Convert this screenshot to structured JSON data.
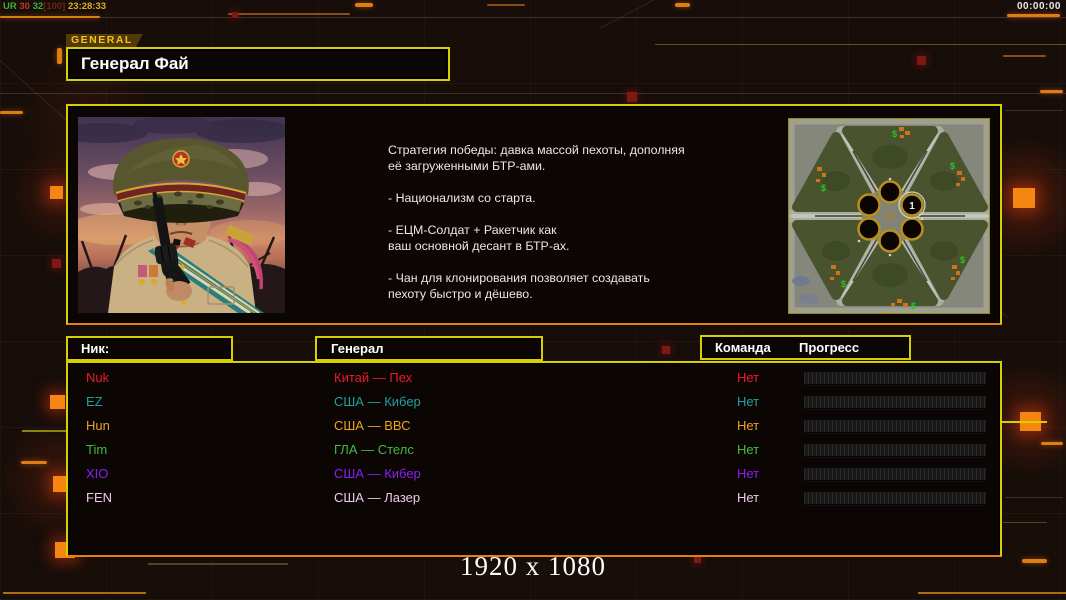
{
  "hud": {
    "stats": [
      {
        "text": "UR ",
        "color": "#3fae3f"
      },
      {
        "text": "30 ",
        "color": "#c23a26"
      },
      {
        "text": "32",
        "color": "#3fae3f"
      },
      {
        "text": "[100] ",
        "color": "#6e2418"
      },
      {
        "text": "23:28:33",
        "color": "#d9b31e"
      }
    ],
    "timer": "00:00:00"
  },
  "header": {
    "tab": "GENERAL",
    "title": "Генерал Фай"
  },
  "info": {
    "strategy_text": "Стратегия победы: давка массой пехоты, дополняя\n её загруженными БТР-ами.\n\n- Национализм со старта.\n\n- ЕЦМ-Солдат + Ракетчик как\nваш основной десант в БТР-ах.\n\n- Чан для клонирования позволяет создавать\n пехоту быстро и дёшево."
  },
  "map": {
    "position_label": "1"
  },
  "table": {
    "headers": {
      "nick": "Ник:",
      "general": "Генерал",
      "team": "Команда",
      "progress": "Прогресс"
    },
    "rows": [
      {
        "nick": "Nuk",
        "general": "Китай — Пех",
        "team": "Нет",
        "color": "#f01a28",
        "progress_percent": 0
      },
      {
        "nick": "EZ",
        "general": "США — Кибер",
        "team": "Нет",
        "color": "#1fa0a0",
        "progress_percent": 0
      },
      {
        "nick": "Hun",
        "general": "США — ВВС",
        "team": "Нет",
        "color": "#eda41e",
        "progress_percent": 0
      },
      {
        "nick": "Tim",
        "general": "ГЛА — Стелс",
        "team": "Нет",
        "color": "#41bc41",
        "progress_percent": 0
      },
      {
        "nick": "XIO",
        "general": "США — Кибер",
        "team": "Нет",
        "color": "#8c1ef5",
        "progress_percent": 0
      },
      {
        "nick": "FEN",
        "general": "США — Лазер",
        "team": "Нет",
        "color": "#f2c8ee",
        "progress_percent": 0
      }
    ]
  },
  "footer": {
    "resolution": "1920 x 1080"
  },
  "colors": {
    "panel_border": "#d8cf00",
    "panel_border_bottom": "#e87d12",
    "accent_orange": "#f5860f",
    "hud_timer_underline": "#c06a10"
  }
}
